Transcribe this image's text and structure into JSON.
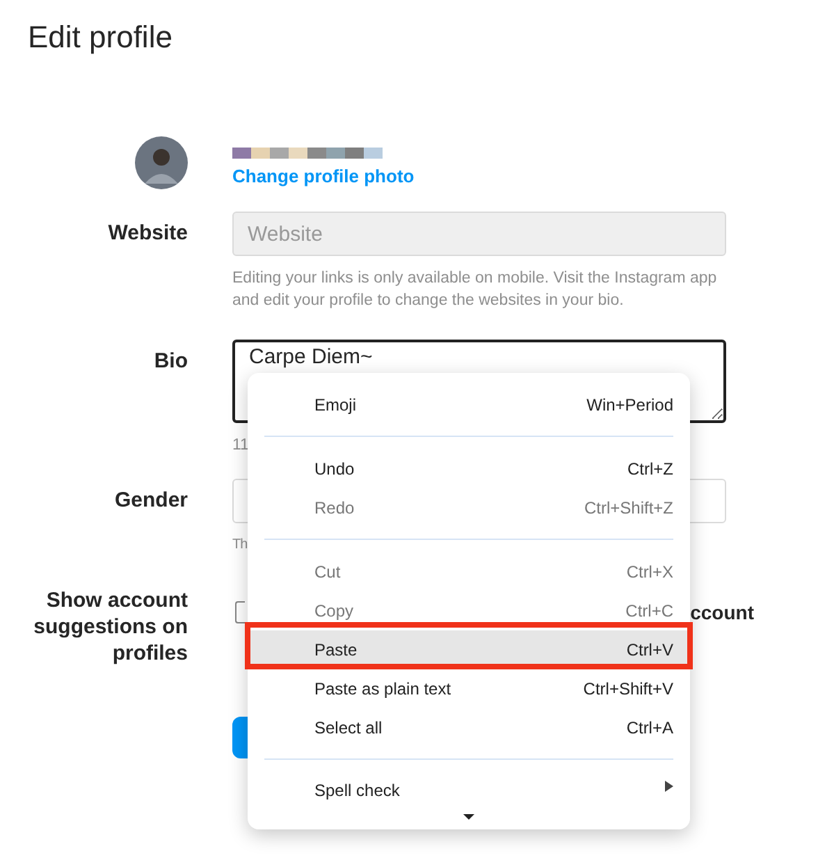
{
  "title": "Edit profile",
  "profile": {
    "link": "Change profile photo"
  },
  "website": {
    "label": "Website",
    "placeholder": "Website",
    "help": "Editing your links is only available on mobile. Visit the Instagram app and edit your profile to change the websites in your bio."
  },
  "bio": {
    "label": "Bio",
    "value": "Carpe Diem~",
    "counter": "11"
  },
  "gender": {
    "label": "Gender",
    "help": "Th"
  },
  "suggestions": {
    "label": "Show account suggestions on profiles",
    "text": "ccount",
    "checked": false
  },
  "context_menu": {
    "items": [
      {
        "kind": "item",
        "label": "Emoji",
        "shortcut": "Win+Period",
        "disabled": false,
        "selected": false
      },
      {
        "kind": "separator"
      },
      {
        "kind": "item",
        "label": "Undo",
        "shortcut": "Ctrl+Z",
        "disabled": false,
        "selected": false
      },
      {
        "kind": "item",
        "label": "Redo",
        "shortcut": "Ctrl+Shift+Z",
        "disabled": true,
        "selected": false
      },
      {
        "kind": "separator"
      },
      {
        "kind": "item",
        "label": "Cut",
        "shortcut": "Ctrl+X",
        "disabled": true,
        "selected": false
      },
      {
        "kind": "item",
        "label": "Copy",
        "shortcut": "Ctrl+C",
        "disabled": true,
        "selected": false
      },
      {
        "kind": "item",
        "label": "Paste",
        "shortcut": "Ctrl+V",
        "disabled": false,
        "selected": true
      },
      {
        "kind": "item",
        "label": "Paste as plain text",
        "shortcut": "Ctrl+Shift+V",
        "disabled": false,
        "selected": false
      },
      {
        "kind": "item",
        "label": "Select all",
        "shortcut": "Ctrl+A",
        "disabled": false,
        "selected": false
      },
      {
        "kind": "separator"
      },
      {
        "kind": "submenu",
        "label": "Spell check",
        "disabled": false,
        "selected": false
      }
    ]
  }
}
